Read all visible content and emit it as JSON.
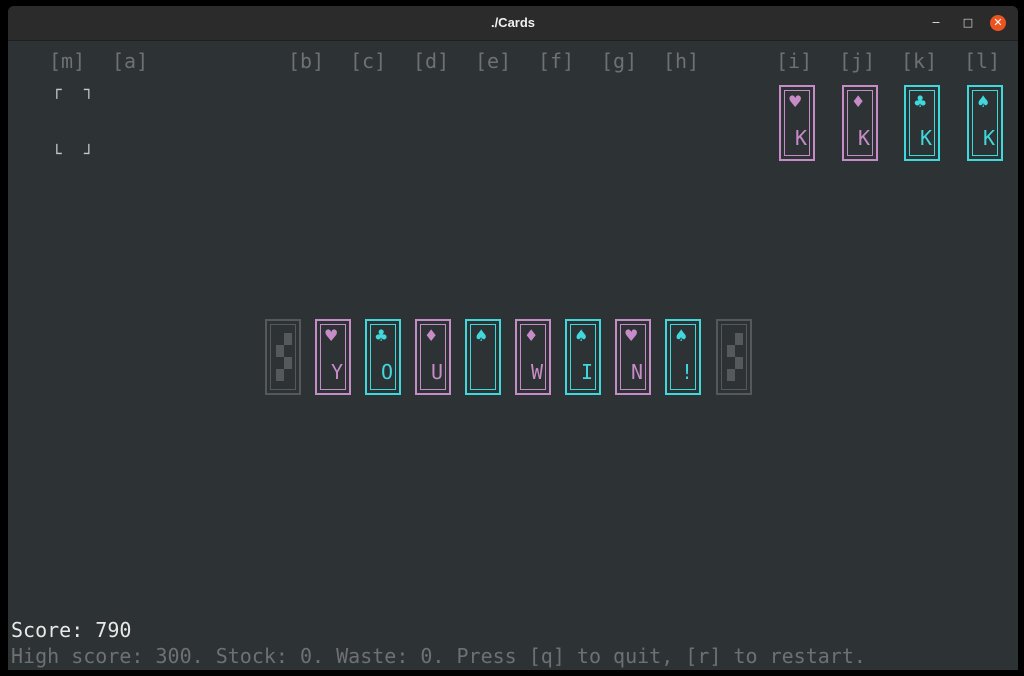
{
  "window": {
    "title": "./Cards"
  },
  "pile_labels": [
    "[m]",
    "[a]",
    "[b]",
    "[c]",
    "[d]",
    "[e]",
    "[f]",
    "[g]",
    "[h]",
    "[i]",
    "[j]",
    "[k]",
    "[l]"
  ],
  "foundations": [
    {
      "suit": "♥",
      "rank": "K",
      "color": "#c78bc8"
    },
    {
      "suit": "♦",
      "rank": "K",
      "color": "#c78bc8"
    },
    {
      "suit": "♣",
      "rank": "K",
      "color": "#3fd8dd"
    },
    {
      "suit": "♠",
      "rank": "K",
      "color": "#3fd8dd"
    }
  ],
  "win_cards": [
    {
      "suit": "♥",
      "rank": "Y",
      "color": "#c78bc8"
    },
    {
      "suit": "♣",
      "rank": "O",
      "color": "#3fd8dd"
    },
    {
      "suit": "♦",
      "rank": "U",
      "color": "#c78bc8"
    },
    {
      "suit": "♠",
      "rank": "",
      "color": "#3fd8dd"
    },
    {
      "suit": "♦",
      "rank": "W",
      "color": "#c78bc8"
    },
    {
      "suit": "♠",
      "rank": "I",
      "color": "#3fd8dd"
    },
    {
      "suit": "♥",
      "rank": "N",
      "color": "#c78bc8"
    },
    {
      "suit": "♠",
      "rank": "!",
      "color": "#3fd8dd"
    }
  ],
  "score_text": "Score: 790",
  "status_text": "High score: 300. Stock: 0. Waste: 0. Press [q] to quit, [r] to restart.",
  "colors": {
    "background": "#2d3234",
    "pink": "#c78bc8",
    "cyan": "#3fd8dd",
    "dim": "#6e7173"
  }
}
